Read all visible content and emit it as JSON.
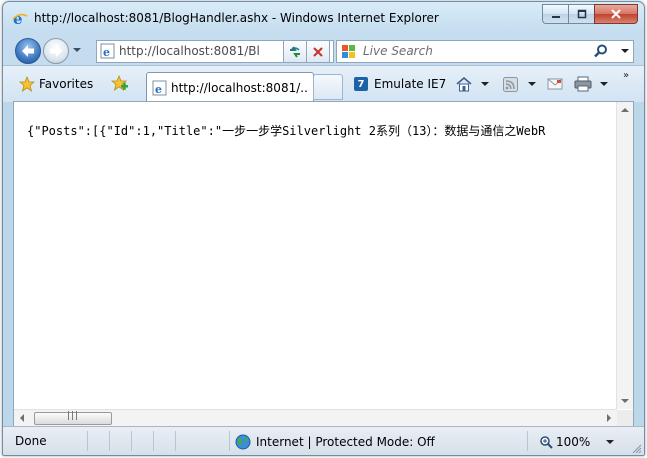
{
  "window": {
    "title": "http://localhost:8081/BlogHandler.ashx - Windows Internet Explorer"
  },
  "address": {
    "url_display": "http://localhost:8081/Bl"
  },
  "search": {
    "placeholder": "Live Search"
  },
  "toolbar": {
    "favorites_label": "Favorites",
    "tab_title": "http://localhost:8081/...",
    "emulate_label": "Emulate IE7",
    "emulate_badge": "7",
    "chevron": "»"
  },
  "content": {
    "text": "{\"Posts\":[{\"Id\":1,\"Title\":\"一步一步学Silverlight 2系列（13）：数据与通信之WebR"
  },
  "statusbar": {
    "status": "Done",
    "zone": "Internet | Protected Mode: Off",
    "zoom": "100%"
  },
  "icons": {
    "page_icon": "ie-page-icon",
    "back": "back-arrow-icon",
    "forward": "forward-arrow-icon",
    "refresh": "refresh-icon",
    "stop": "stop-icon",
    "search_provider": "windows-logo-icon",
    "search": "magnifier-icon",
    "favorites": "star-icon",
    "add_favorite": "add-favorite-icon",
    "home": "home-icon",
    "feeds": "rss-feed-icon",
    "mail": "mail-icon",
    "print": "printer-icon",
    "zone": "globe-icon",
    "zoom": "zoom-icon"
  },
  "colors": {
    "frame": "#c4dcee",
    "close_button": "#c0422e",
    "content_bg": "#ffffff"
  }
}
